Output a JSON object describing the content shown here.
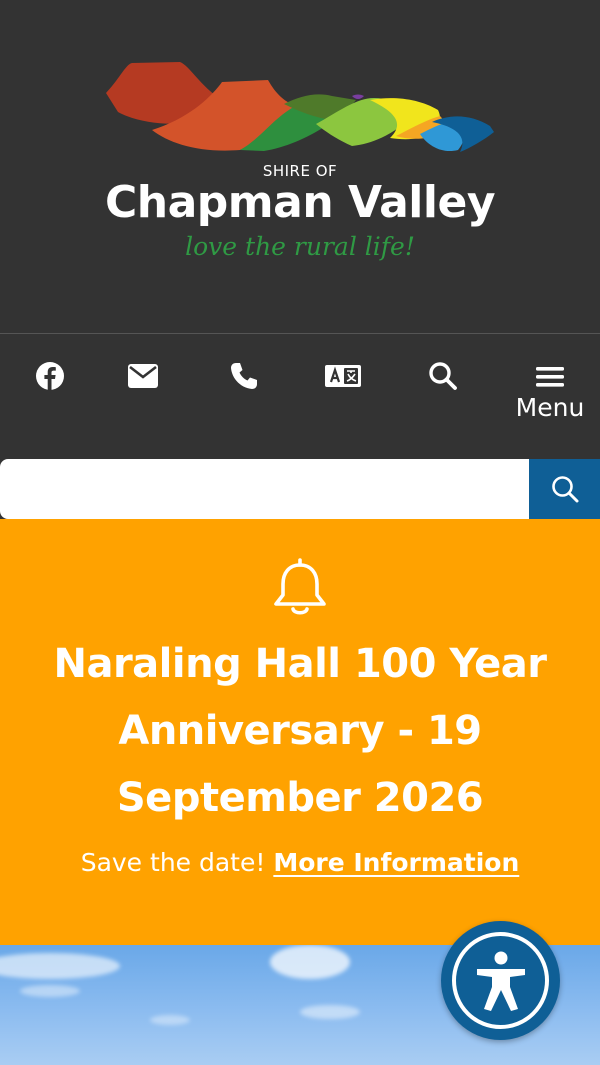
{
  "header": {
    "logo_pre": "SHIRE OF",
    "logo_name": "Chapman Valley",
    "logo_tagline": "love the rural life!"
  },
  "toolbar": {
    "items": [
      {
        "icon": "facebook-icon"
      },
      {
        "icon": "mail-icon"
      },
      {
        "icon": "phone-icon"
      },
      {
        "icon": "translate-icon"
      },
      {
        "icon": "search-icon"
      },
      {
        "icon": "menu-icon",
        "label": "Menu"
      }
    ]
  },
  "search": {
    "value": "",
    "placeholder": "",
    "button_icon": "search-icon"
  },
  "alert": {
    "icon": "bell-icon",
    "title": "Naraling Hall 100 Year Anniversary - 19 September 2026",
    "text": "Save the date!",
    "link_label": "More Information"
  },
  "colors": {
    "header_bg": "#333333",
    "alert_bg": "#ffa200",
    "accent_blue": "#0f5f96",
    "tagline_green": "#2f9a44"
  }
}
